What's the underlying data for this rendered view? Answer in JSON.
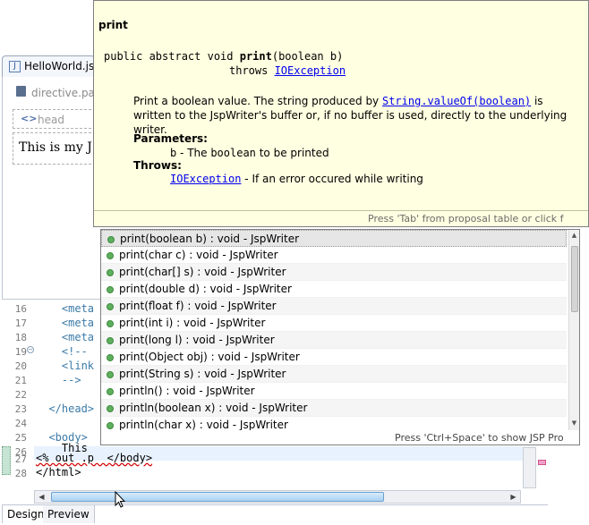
{
  "editor": {
    "tab_title": "HelloWorld.jsp",
    "tab_icon": "J",
    "design": {
      "directive_label": "directive.page",
      "head_label": "head",
      "body_text": "This is my JSP"
    },
    "source": {
      "lines": [
        {
          "num": "16",
          "text": "    <meta"
        },
        {
          "num": "17",
          "text": "    <meta"
        },
        {
          "num": "18",
          "text": "    <meta"
        },
        {
          "num": "19",
          "text": "    <!--"
        },
        {
          "num": "20",
          "text": "    <link"
        },
        {
          "num": "21",
          "text": "    -->"
        },
        {
          "num": "22",
          "text": ""
        },
        {
          "num": "23",
          "text": "  </head>"
        },
        {
          "num": "24",
          "text": ""
        },
        {
          "num": "25",
          "text": "  <body>"
        },
        {
          "num": "26",
          "text": "    This"
        },
        {
          "num": "27",
          "text": "<% out .p  </body>"
        },
        {
          "num": "28",
          "text": "</html>"
        }
      ]
    },
    "bottom_tabs": {
      "design": "Design",
      "preview": "Preview"
    }
  },
  "javadoc": {
    "title": "print",
    "sig_prefix": "public abstract void ",
    "sig_method": "print",
    "sig_params": "(boolean b)",
    "throws_kw": "throws ",
    "throws_link": "IOException",
    "desc_before": "Print a boolean value. The string produced by ",
    "desc_link": "String.valueOf(boolean)",
    "desc_after": " is written to the JspWriter's buffer or, if no buffer is used, directly to the underlying writer.",
    "params_heading": "Parameters:",
    "param_b_name": "b",
    "param_b_sep": " - The ",
    "param_b_type": "boolean",
    "param_b_desc": " to be printed",
    "throws_heading": "Throws:",
    "throws_item_link": "IOException",
    "throws_item_desc": " - If an error occured while writing",
    "footer": "Press 'Tab' from proposal table or click f"
  },
  "proposals": {
    "items": [
      "print(boolean b) : void - JspWriter",
      "print(char c) : void - JspWriter",
      "print(char[] s) : void - JspWriter",
      "print(double d) : void - JspWriter",
      "print(float f) : void - JspWriter",
      "print(int i) : void - JspWriter",
      "print(long l) : void - JspWriter",
      "print(Object obj) : void - JspWriter",
      "print(String s) : void - JspWriter",
      "println() : void - JspWriter",
      "println(boolean x) : void - JspWriter",
      "println(char x) : void - JspWriter"
    ],
    "selected_index": 0,
    "footer": "Press 'Ctrl+Space' to show JSP Pro"
  },
  "colors": {
    "javadoc_bg": "#ffffe1",
    "proposal_icon": "#5db05d",
    "current_line": "#e8f2fe",
    "link": "#0000ee"
  },
  "icons": {
    "tab": "jsp-file-icon",
    "directive": "directive-icon",
    "head": "html-tag-icon",
    "proposal": "public-method-icon",
    "fold": "fold-collapse-icon"
  }
}
